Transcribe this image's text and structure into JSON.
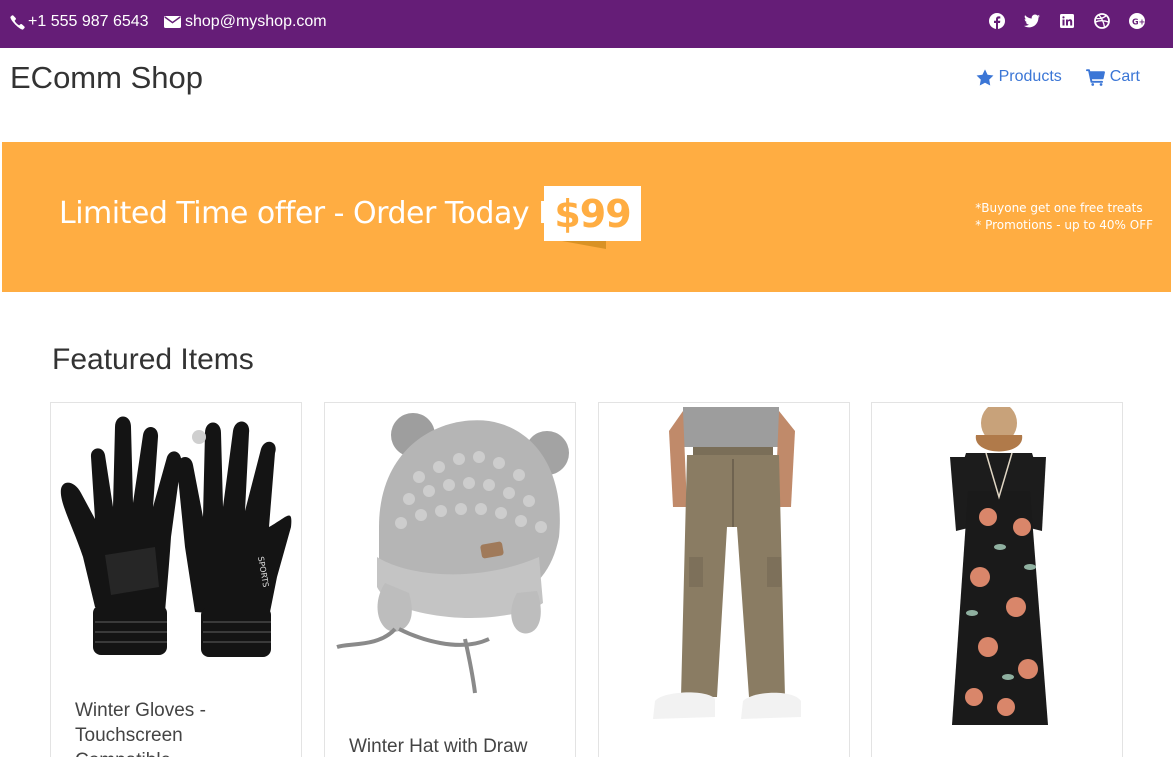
{
  "topbar": {
    "phone": "+1 555 987 6543",
    "email": "shop@myshop.com",
    "social_icons": [
      "facebook-icon",
      "twitter-icon",
      "linkedin-icon",
      "dribbble-icon",
      "google-plus-icon"
    ],
    "background_color": "#651d77"
  },
  "header": {
    "brand": "EComm Shop",
    "nav": [
      {
        "label": "Products",
        "icon": "star-icon"
      },
      {
        "label": "Cart",
        "icon": "cart-icon"
      }
    ],
    "link_color": "#3b76d6"
  },
  "banner": {
    "text": "Limited Time offer - Order Today For",
    "price": "$99",
    "notes": [
      "*Buyone get one free treats",
      "* Promotions - up to 40% OFF"
    ],
    "background_color": "#ffad42"
  },
  "featured": {
    "title": "Featured Items",
    "items": [
      {
        "title": "Winter Gloves - Touchscreen Compatible",
        "image": "black-gloves"
      },
      {
        "title": "Winter Hat with Draw",
        "image": "grey-knit-hat"
      },
      {
        "title": "",
        "image": "khaki-cargo-pants"
      },
      {
        "title": "",
        "image": "floral-maxi-dress"
      }
    ]
  }
}
